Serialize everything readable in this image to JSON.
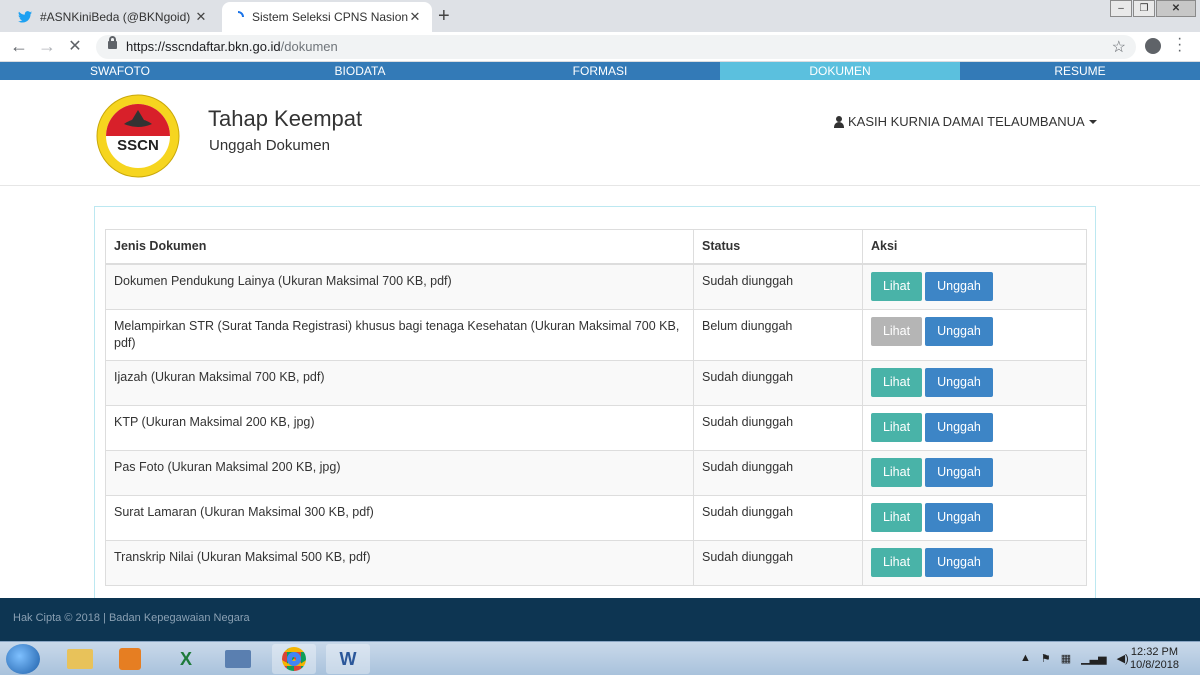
{
  "browser": {
    "tabs": [
      {
        "title": "#ASNKiniBeda (@BKNgoid) | Twi",
        "icon": "twitter-icon"
      },
      {
        "title": "Sistem Seleksi CPNS Nasional",
        "icon": "loading-icon"
      }
    ],
    "url_host": "https://sscndaftar.bkn.go.id",
    "url_path": "/dokumen"
  },
  "steps": [
    "SWAFOTO",
    "BIODATA",
    "FORMASI",
    "DOKUMEN",
    "RESUME"
  ],
  "active_step": "DOKUMEN",
  "header": {
    "logo_text": "SSCN",
    "stage_title": "Tahap Keempat",
    "stage_subtitle": "Unggah Dokumen",
    "user_name": "KASIH KURNIA DAMAI TELAUMBANUA"
  },
  "table": {
    "headers": [
      "Jenis Dokumen",
      "Status",
      "Aksi"
    ],
    "view_label": "Lihat",
    "upload_label": "Unggah",
    "rows": [
      {
        "doc": "Dokumen Pendukung Lainya (Ukuran Maksimal 700 KB, pdf)",
        "status": "Sudah diunggah",
        "view_enabled": true
      },
      {
        "doc": "Melampirkan STR (Surat Tanda Registrasi) khusus bagi tenaga Kesehatan (Ukuran Maksimal 700 KB, pdf)",
        "status": "Belum diunggah",
        "view_enabled": false
      },
      {
        "doc": "Ijazah (Ukuran Maksimal 700 KB, pdf)",
        "status": "Sudah diunggah",
        "view_enabled": true
      },
      {
        "doc": "KTP (Ukuran Maksimal 200 KB, jpg)",
        "status": "Sudah diunggah",
        "view_enabled": true
      },
      {
        "doc": "Pas Foto (Ukuran Maksimal 200 KB, jpg)",
        "status": "Sudah diunggah",
        "view_enabled": true
      },
      {
        "doc": "Surat Lamaran (Ukuran Maksimal 300 KB, pdf)",
        "status": "Sudah diunggah",
        "view_enabled": true
      },
      {
        "doc": "Transkrip Nilai (Ukuran Maksimal 500 KB, pdf)",
        "status": "Sudah diunggah",
        "view_enabled": true
      }
    ]
  },
  "footer": {
    "text": "Hak Cipta © 2018 | Badan Kepegawaian Negara"
  },
  "taskbar": {
    "time": "12:32 PM",
    "date": "10/8/2018"
  },
  "colors": {
    "primary": "#337ab7",
    "active_step": "#5bc0de",
    "view_button": "#49b3a8",
    "upload_button": "#3d85c6",
    "footer": "#0d3552"
  }
}
